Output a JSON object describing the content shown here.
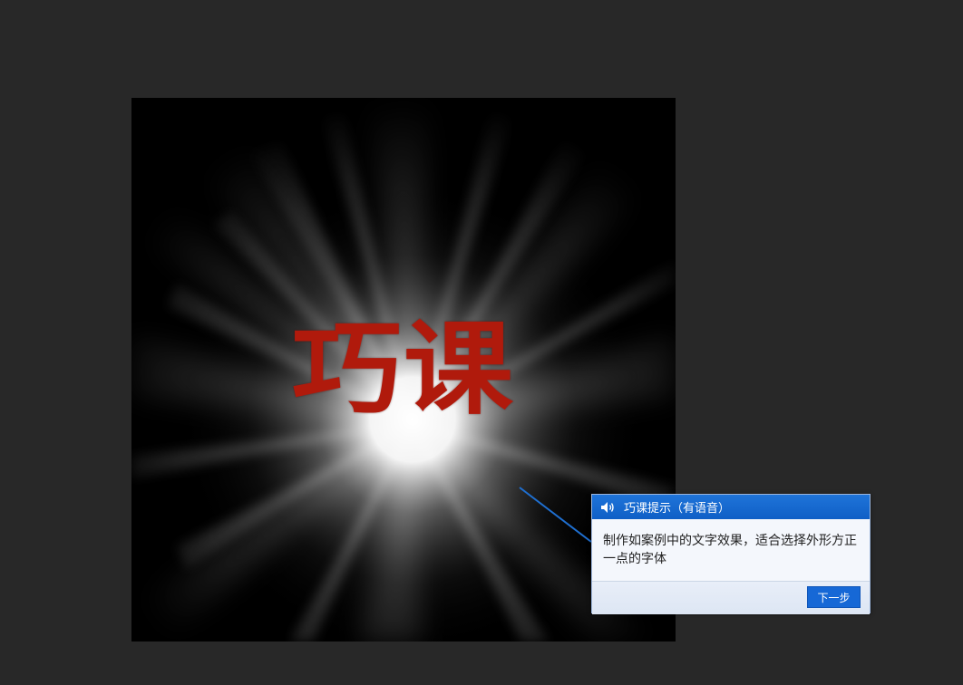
{
  "canvas": {
    "art_text": "巧课",
    "text_color": "#b01a0c",
    "glow_color": "#ffffff",
    "background_color": "#000000"
  },
  "hint": {
    "title": "巧课提示（有语音）",
    "speaker_icon": "speaker-icon",
    "message": "制作如案例中的文字效果，适合选择外形方正一点的字体",
    "next_label": "下一步",
    "header_color": "#1668d6"
  }
}
